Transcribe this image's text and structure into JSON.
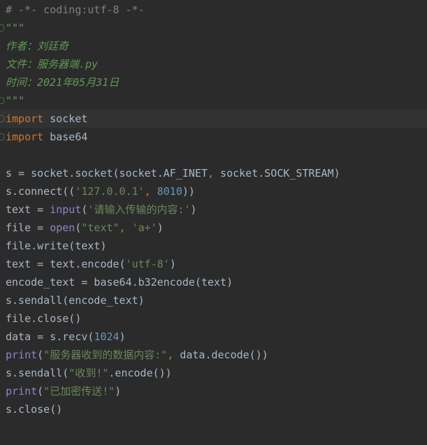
{
  "editor": {
    "language": "python",
    "colors": {
      "background": "#2b2b2b",
      "current_line": "#323232",
      "default": "#a9b7c6",
      "comment": "#808080",
      "docstring": "#629755",
      "keyword": "#cc7832",
      "string": "#6a8759",
      "number": "#6897bb",
      "builtin": "#8888c6"
    },
    "lines": [
      {
        "tokens": [
          {
            "t": "# -*- coding:utf-8 -*-",
            "k": "cm"
          }
        ]
      },
      {
        "fold": true,
        "tokens": [
          {
            "t": "\"\"\"",
            "k": "doc"
          }
        ]
      },
      {
        "tokens": [
          {
            "t": "作者：刘廷奇",
            "k": "doc"
          }
        ]
      },
      {
        "tokens": [
          {
            "t": "文件：服务器端.py",
            "k": "doc"
          }
        ]
      },
      {
        "tokens": [
          {
            "t": "时间：2021年05月31日",
            "k": "doc"
          }
        ]
      },
      {
        "fold": true,
        "tokens": [
          {
            "t": "\"\"\"",
            "k": "doc"
          }
        ]
      },
      {
        "fold": true,
        "current": true,
        "tokens": [
          {
            "t": "import",
            "k": "kw"
          },
          {
            "t": " socket",
            "k": "pl"
          }
        ]
      },
      {
        "fold": true,
        "tokens": [
          {
            "t": "import",
            "k": "kw"
          },
          {
            "t": " base64",
            "k": "pl"
          }
        ]
      },
      {
        "tokens": []
      },
      {
        "tokens": [
          {
            "t": "s = socket.socket(socket.AF_INET",
            "k": "pl"
          },
          {
            "t": ",",
            "k": "kw"
          },
          {
            "t": " socket.SOCK_STREAM)",
            "k": "pl"
          }
        ]
      },
      {
        "tokens": [
          {
            "t": "s.connect((",
            "k": "pl"
          },
          {
            "t": "'127.0.0.1'",
            "k": "str"
          },
          {
            "t": ",",
            "k": "kw"
          },
          {
            "t": " ",
            "k": "pl"
          },
          {
            "t": "8010",
            "k": "num"
          },
          {
            "t": "))",
            "k": "pl"
          }
        ]
      },
      {
        "tokens": [
          {
            "t": "text = ",
            "k": "pl"
          },
          {
            "t": "input",
            "k": "bi"
          },
          {
            "t": "(",
            "k": "pl"
          },
          {
            "t": "'请输入传输的内容:'",
            "k": "str"
          },
          {
            "t": ")",
            "k": "pl"
          }
        ]
      },
      {
        "tokens": [
          {
            "t": "file = ",
            "k": "pl"
          },
          {
            "t": "open",
            "k": "bi"
          },
          {
            "t": "(",
            "k": "pl"
          },
          {
            "t": "\"text\"",
            "k": "str"
          },
          {
            "t": ",",
            "k": "kw"
          },
          {
            "t": " ",
            "k": "pl"
          },
          {
            "t": "'a+'",
            "k": "str"
          },
          {
            "t": ")",
            "k": "pl"
          }
        ]
      },
      {
        "tokens": [
          {
            "t": "file.write(text)",
            "k": "pl"
          }
        ]
      },
      {
        "tokens": [
          {
            "t": "text = text.encode(",
            "k": "pl"
          },
          {
            "t": "'utf-8'",
            "k": "str"
          },
          {
            "t": ")",
            "k": "pl"
          }
        ]
      },
      {
        "tokens": [
          {
            "t": "encode_text = base64.b32encode(text)",
            "k": "pl"
          }
        ]
      },
      {
        "tokens": [
          {
            "t": "s.sendall(encode_text)",
            "k": "pl"
          }
        ]
      },
      {
        "tokens": [
          {
            "t": "file.close()",
            "k": "pl"
          }
        ]
      },
      {
        "tokens": [
          {
            "t": "data = s.recv(",
            "k": "pl"
          },
          {
            "t": "1024",
            "k": "num"
          },
          {
            "t": ")",
            "k": "pl"
          }
        ]
      },
      {
        "tokens": [
          {
            "t": "print",
            "k": "bi"
          },
          {
            "t": "(",
            "k": "pl"
          },
          {
            "t": "\"服务器收到的数据内容:\"",
            "k": "str"
          },
          {
            "t": ",",
            "k": "kw"
          },
          {
            "t": " data.decode())",
            "k": "pl"
          }
        ]
      },
      {
        "tokens": [
          {
            "t": "s.sendall(",
            "k": "pl"
          },
          {
            "t": "\"收到!\"",
            "k": "str"
          },
          {
            "t": ".encode())",
            "k": "pl"
          }
        ]
      },
      {
        "tokens": [
          {
            "t": "print",
            "k": "bi"
          },
          {
            "t": "(",
            "k": "pl"
          },
          {
            "t": "\"已加密传送!\"",
            "k": "str"
          },
          {
            "t": ")",
            "k": "pl"
          }
        ]
      },
      {
        "tokens": [
          {
            "t": "s.close()",
            "k": "pl"
          }
        ]
      }
    ]
  }
}
